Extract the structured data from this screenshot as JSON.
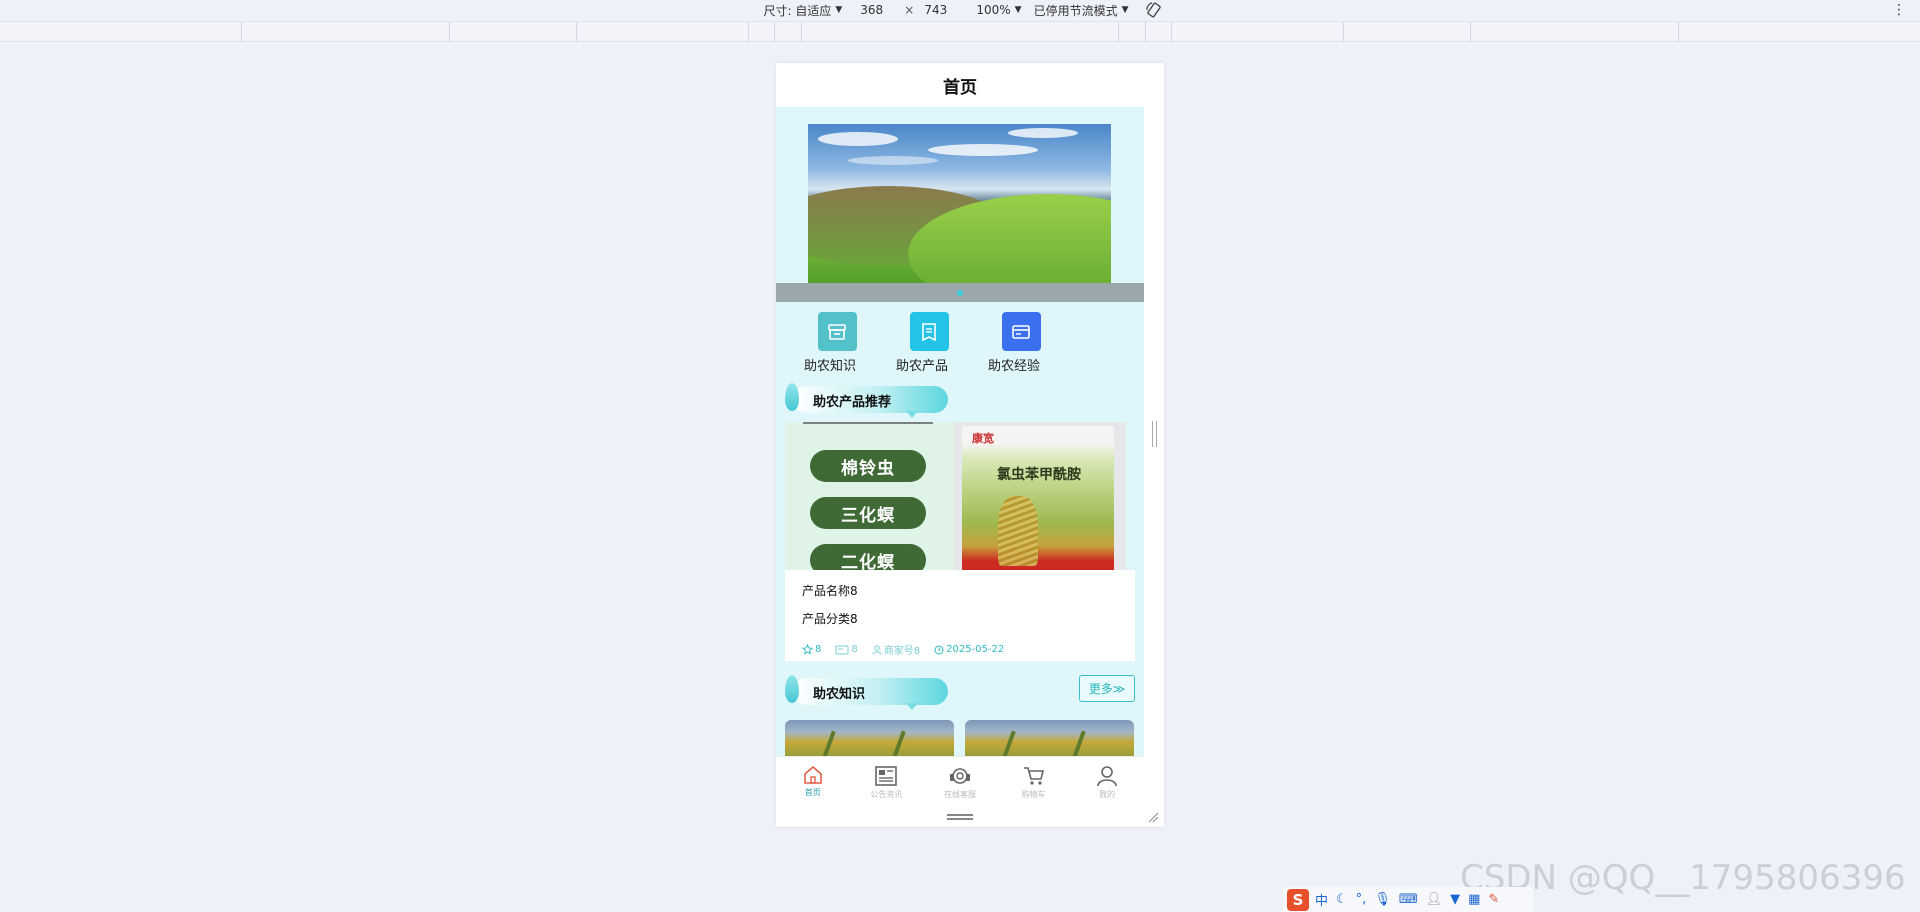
{
  "devtools": {
    "dimensions_label": "尺寸: 自适应",
    "width": "368",
    "times": "×",
    "height": "743",
    "zoom": "100%",
    "throttle": "已停用节流模式"
  },
  "page": {
    "title": "首页"
  },
  "quick_nav": [
    {
      "label": "助农知识",
      "color": "#53c1c9",
      "icon": "store-icon"
    },
    {
      "label": "助农产品",
      "color": "#22c3e6",
      "icon": "document-icon"
    },
    {
      "label": "助农经验",
      "color": "#3a6ff0",
      "icon": "card-icon"
    }
  ],
  "products_section": {
    "title": "助农产品推荐",
    "pests": [
      "棉铃虫",
      "三化螟",
      "二化螟"
    ],
    "package": {
      "brand": "康宽",
      "name": "氯虫苯甲酰胺"
    },
    "product": {
      "name": "产品名称8",
      "category": "产品分类8",
      "likes": "8",
      "views": "8",
      "merchant": "商家号8",
      "date": "2025-05-22"
    }
  },
  "knowledge_section": {
    "title": "助农知识",
    "more": "更多≫"
  },
  "tabbar": [
    {
      "label": "首页",
      "icon": "home-icon",
      "active": true
    },
    {
      "label": "公告资讯",
      "icon": "news-icon",
      "active": false
    },
    {
      "label": "在线客服",
      "icon": "headset-icon",
      "active": false
    },
    {
      "label": "购物车",
      "icon": "cart-icon",
      "active": false
    },
    {
      "label": "我的",
      "icon": "user-icon",
      "active": false
    }
  ],
  "ime": {
    "mode": "中"
  },
  "watermark": "CSDN @QQ__1795806396",
  "colors": {
    "accent": "#2bb4c0",
    "page_bg": "#dff7fb",
    "pest_pill": "#3f6a36"
  }
}
